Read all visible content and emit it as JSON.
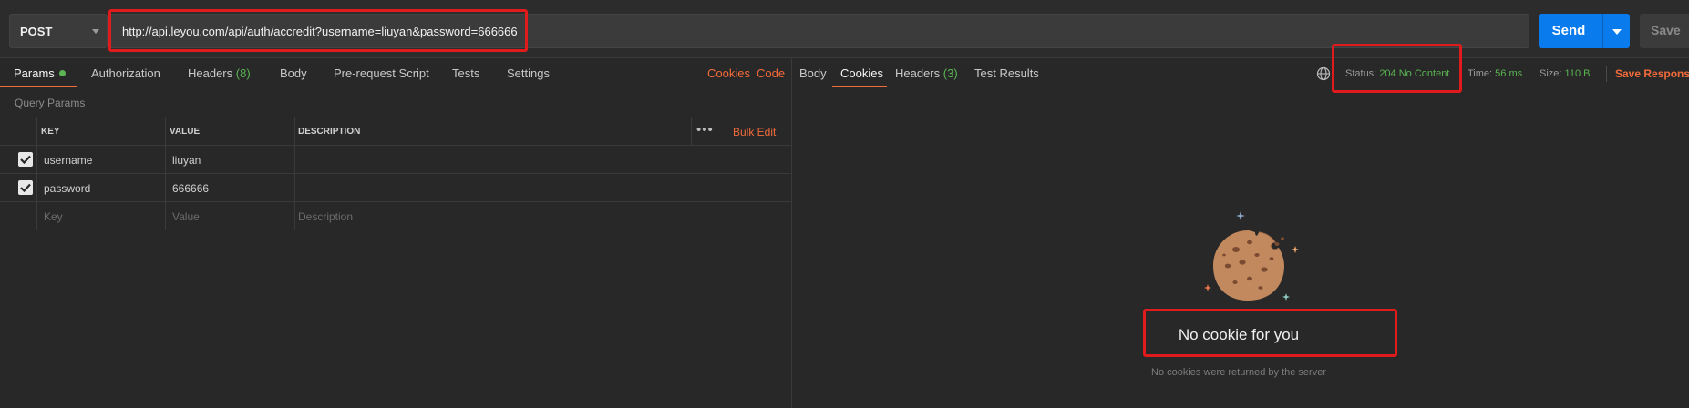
{
  "request": {
    "method": "POST",
    "url": "http://api.leyou.com/api/auth/accredit?username=liuyan&password=666666",
    "send_label": "Send",
    "save_label": "Save"
  },
  "request_tabs": [
    {
      "label": "Params",
      "active": true
    },
    {
      "label": "Authorization"
    },
    {
      "label": "Headers",
      "count": "(8)"
    },
    {
      "label": "Body"
    },
    {
      "label": "Pre-request Script"
    },
    {
      "label": "Tests"
    },
    {
      "label": "Settings"
    }
  ],
  "request_links": {
    "cookies": "Cookies",
    "code": "Code"
  },
  "query_params": {
    "title": "Query Params",
    "columns": {
      "key": "KEY",
      "value": "VALUE",
      "description": "DESCRIPTION"
    },
    "more_label": "•••",
    "bulk_edit_label": "Bulk Edit",
    "rows": [
      {
        "checked": true,
        "key": "username",
        "value": "liuyan",
        "description": ""
      },
      {
        "checked": true,
        "key": "password",
        "value": "666666",
        "description": ""
      }
    ],
    "new_row": {
      "key": "Key",
      "value": "Value",
      "description": "Description"
    }
  },
  "response_tabs": [
    {
      "label": "Body"
    },
    {
      "label": "Cookies",
      "active": true
    },
    {
      "label": "Headers",
      "count": "(3)"
    },
    {
      "label": "Test Results"
    }
  ],
  "response_meta": {
    "status_label": "Status:",
    "status_value": "204 No Content",
    "time_label": "Time:",
    "time_value": "56 ms",
    "size_label": "Size:",
    "size_value": "110 B",
    "save_response_label": "Save Response"
  },
  "cookies_empty": {
    "title": "No cookie for you",
    "subtitle": "No cookies were returned by the server",
    "icon": "cookie-icon"
  },
  "colors": {
    "accent": "#f26b3a",
    "send": "#097bed",
    "success": "#5ab552",
    "annotation": "#e11b1b",
    "background": "#282828"
  }
}
